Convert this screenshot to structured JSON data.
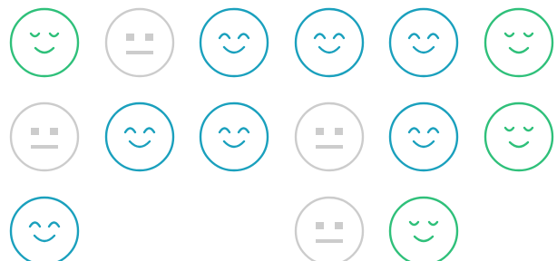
{
  "colors": {
    "happy": "#1aa0bd",
    "content": "#2fc07a",
    "neutral": "#cccccc"
  },
  "faces": [
    {
      "row": 0,
      "col": 0,
      "type": "content"
    },
    {
      "row": 0,
      "col": 1,
      "type": "neutral"
    },
    {
      "row": 0,
      "col": 2,
      "type": "happy"
    },
    {
      "row": 0,
      "col": 3,
      "type": "happy"
    },
    {
      "row": 0,
      "col": 4,
      "type": "happy"
    },
    {
      "row": 0,
      "col": 5,
      "type": "content"
    },
    {
      "row": 1,
      "col": 0,
      "type": "neutral"
    },
    {
      "row": 1,
      "col": 1,
      "type": "happy"
    },
    {
      "row": 1,
      "col": 2,
      "type": "happy"
    },
    {
      "row": 1,
      "col": 3,
      "type": "neutral"
    },
    {
      "row": 1,
      "col": 4,
      "type": "happy"
    },
    {
      "row": 1,
      "col": 5,
      "type": "content"
    },
    {
      "row": 2,
      "col": 0,
      "type": "happy"
    },
    {
      "row": 2,
      "col": 3,
      "type": "neutral"
    },
    {
      "row": 2,
      "col": 4,
      "type": "content"
    }
  ]
}
